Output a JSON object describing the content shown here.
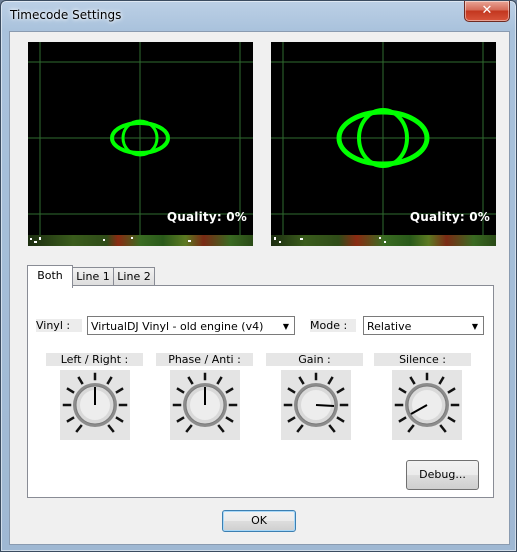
{
  "window": {
    "title": "Timecode Settings",
    "close_glyph": "✕"
  },
  "scopes": [
    {
      "quality_label": "Quality: 0%",
      "signal_color": "#00ff00"
    },
    {
      "quality_label": "Quality: 0%",
      "signal_color": "#00ff00"
    }
  ],
  "tabs": [
    {
      "label": "Both",
      "active": true
    },
    {
      "label": "Line 1",
      "active": false
    },
    {
      "label": "Line 2",
      "active": false
    }
  ],
  "vinyl": {
    "label": "Vinyl :",
    "value": "VirtualDJ Vinyl - old engine (v4)"
  },
  "mode": {
    "label": "Mode :",
    "value": "Relative"
  },
  "knobs": [
    {
      "label": "Left / Right :",
      "icon": "knob-icon"
    },
    {
      "label": "Phase / Anti :",
      "icon": "knob-icon"
    },
    {
      "label": "Gain :",
      "icon": "knob-icon"
    },
    {
      "label": "Silence :",
      "icon": "knob-icon"
    }
  ],
  "buttons": {
    "debug": "Debug...",
    "ok": "OK"
  },
  "colors": {
    "accent_blue": "#3c7fb1",
    "close_red": "#c3371f"
  }
}
